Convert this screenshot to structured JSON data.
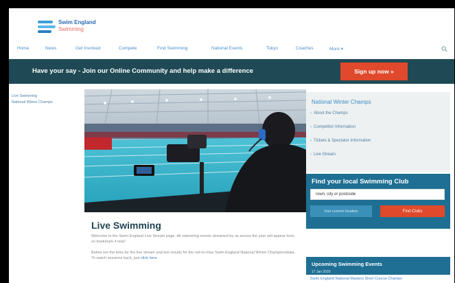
{
  "brand": {
    "line1": "Swim England",
    "line2": "Swimming",
    "accent": "#3a9fd6",
    "secondary": "#e06a5a"
  },
  "nav": {
    "items": [
      "Home",
      "News",
      "Get Involved",
      "Compete",
      "Find Swimming",
      "National Events",
      "Tokyo",
      "Coaches",
      "More ▾"
    ],
    "search_icon": "search-icon"
  },
  "banner": {
    "text": "Have your say - Join our Online Community and help make a difference",
    "cta": "Sign up now »",
    "bg": "#1f4a55",
    "cta_color": "#e0492b"
  },
  "left_links": [
    "Live Swimming",
    "National Winter Champs"
  ],
  "main": {
    "title": "Live Swimming",
    "para1": "Welcome to the Swim England Live Stream page. All swimming events streamed by us across the year will appear here, so bookmark it now!",
    "para2": "Below are the links for the live stream and live results for the not-to-miss Swim England National Winter Championships. To watch sessions back, just",
    "para2_link": "click here"
  },
  "sidebar": {
    "title": "National Winter Champs",
    "items": [
      "About the Champs",
      "Competitor Information",
      "Tickets & Spectator Information",
      "Live Stream"
    ]
  },
  "club_finder": {
    "title": "Find your local Swimming Club",
    "input_value": "Town, city or postcode",
    "use_location": "Use current location",
    "find_button": "Find Clubs",
    "bg": "#1e6f93"
  },
  "events": {
    "title": "Upcoming Swimming Events",
    "date": "17 Jan 2020",
    "item": "Swim England National Masters Short Course Champs"
  }
}
